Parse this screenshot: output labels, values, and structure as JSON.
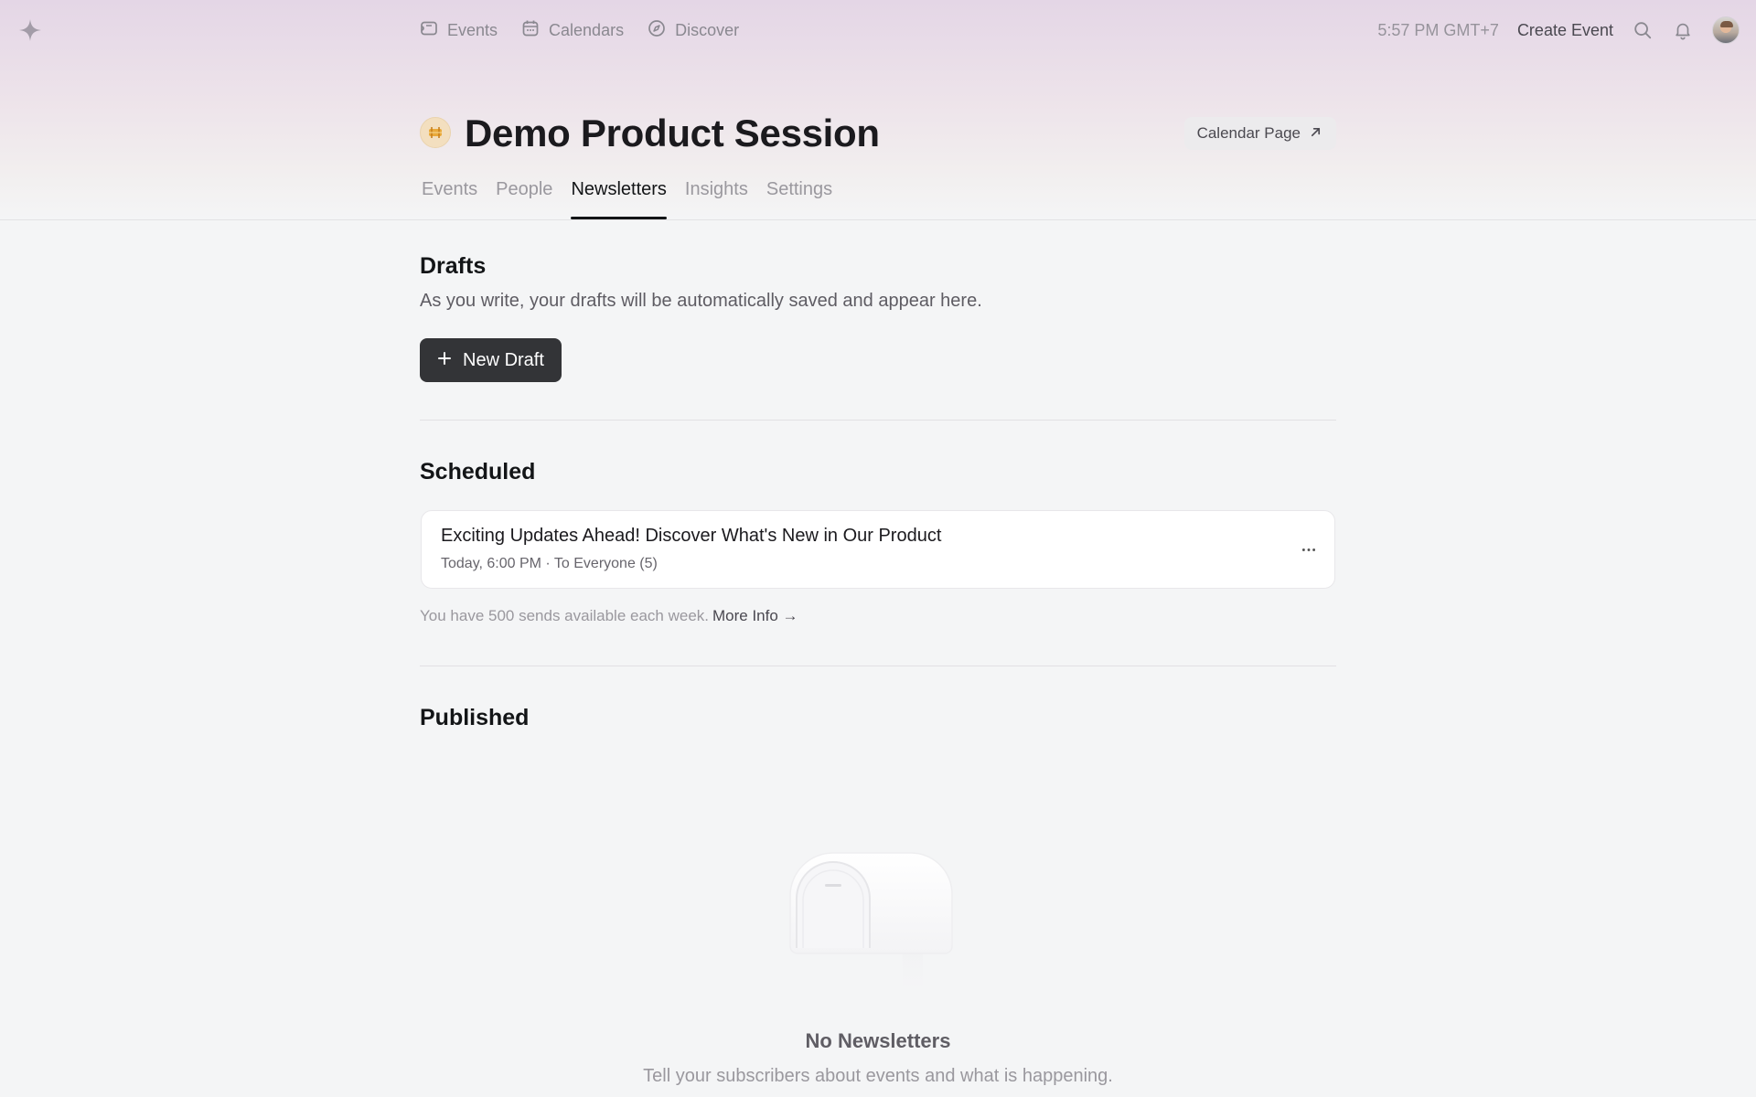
{
  "topbar": {
    "logo_icon": "sparkle-icon",
    "nav": [
      {
        "label": "Events",
        "icon": "ticket-icon"
      },
      {
        "label": "Calendars",
        "icon": "calendar-icon"
      },
      {
        "label": "Discover",
        "icon": "compass-icon"
      }
    ],
    "clock": "5:57 PM GMT+7",
    "create_event": "Create Event",
    "icons": [
      "search-icon",
      "bell-icon",
      "avatar"
    ]
  },
  "header": {
    "title": "Demo Product Session",
    "calendar_page_button": "Calendar Page"
  },
  "tabs": [
    {
      "label": "Events",
      "active": false
    },
    {
      "label": "People",
      "active": false
    },
    {
      "label": "Newsletters",
      "active": true
    },
    {
      "label": "Insights",
      "active": false
    },
    {
      "label": "Settings",
      "active": false
    }
  ],
  "drafts": {
    "title": "Drafts",
    "description": "As you write, your drafts will be automatically saved and appear here.",
    "new_draft_button": "New Draft"
  },
  "scheduled": {
    "title": "Scheduled",
    "items": [
      {
        "title": "Exciting Updates Ahead! Discover What's New in Our Product",
        "meta": "Today, 6:00 PM · To Everyone (5)"
      }
    ],
    "sends_note": "You have 500 sends available each week.",
    "more_info": "More Info →"
  },
  "published": {
    "title": "Published",
    "empty_title": "No Newsletters",
    "empty_description": "Tell your subscribers about events and what is happening."
  },
  "colors": {
    "background": "#f4f5f6",
    "header_gradient_top": "#e4d6e6",
    "primary_button": "#333437",
    "text_primary": "#131517",
    "text_muted": "#9a989e"
  }
}
